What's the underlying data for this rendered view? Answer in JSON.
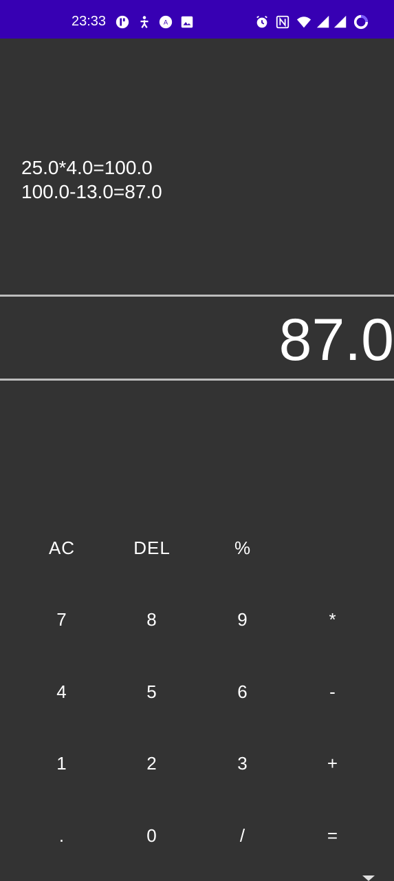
{
  "status_bar": {
    "time": "23:33",
    "left_icons": [
      "app-notification-icon",
      "accessibility-icon",
      "translate-icon",
      "image-icon"
    ],
    "right_icons": [
      "alarm-icon",
      "nfc-icon",
      "wifi-icon",
      "signal-icon",
      "signal-icon-2",
      "battery-ring-icon"
    ]
  },
  "history": {
    "lines": [
      "25.0*4.0=100.0",
      "100.0-13.0=87.0"
    ]
  },
  "display": {
    "result": "87.0"
  },
  "keypad": {
    "rows": [
      [
        "AC",
        "DEL",
        "%",
        ""
      ],
      [
        "7",
        "8",
        "9",
        "*"
      ],
      [
        "4",
        "5",
        "6",
        "-"
      ],
      [
        "1",
        "2",
        "3",
        "+"
      ],
      [
        ".",
        "0",
        "/",
        "="
      ]
    ]
  },
  "colors": {
    "status_bar": "#3700b3",
    "background": "#333333",
    "divider": "#bdbdbd",
    "text": "#ffffff"
  }
}
